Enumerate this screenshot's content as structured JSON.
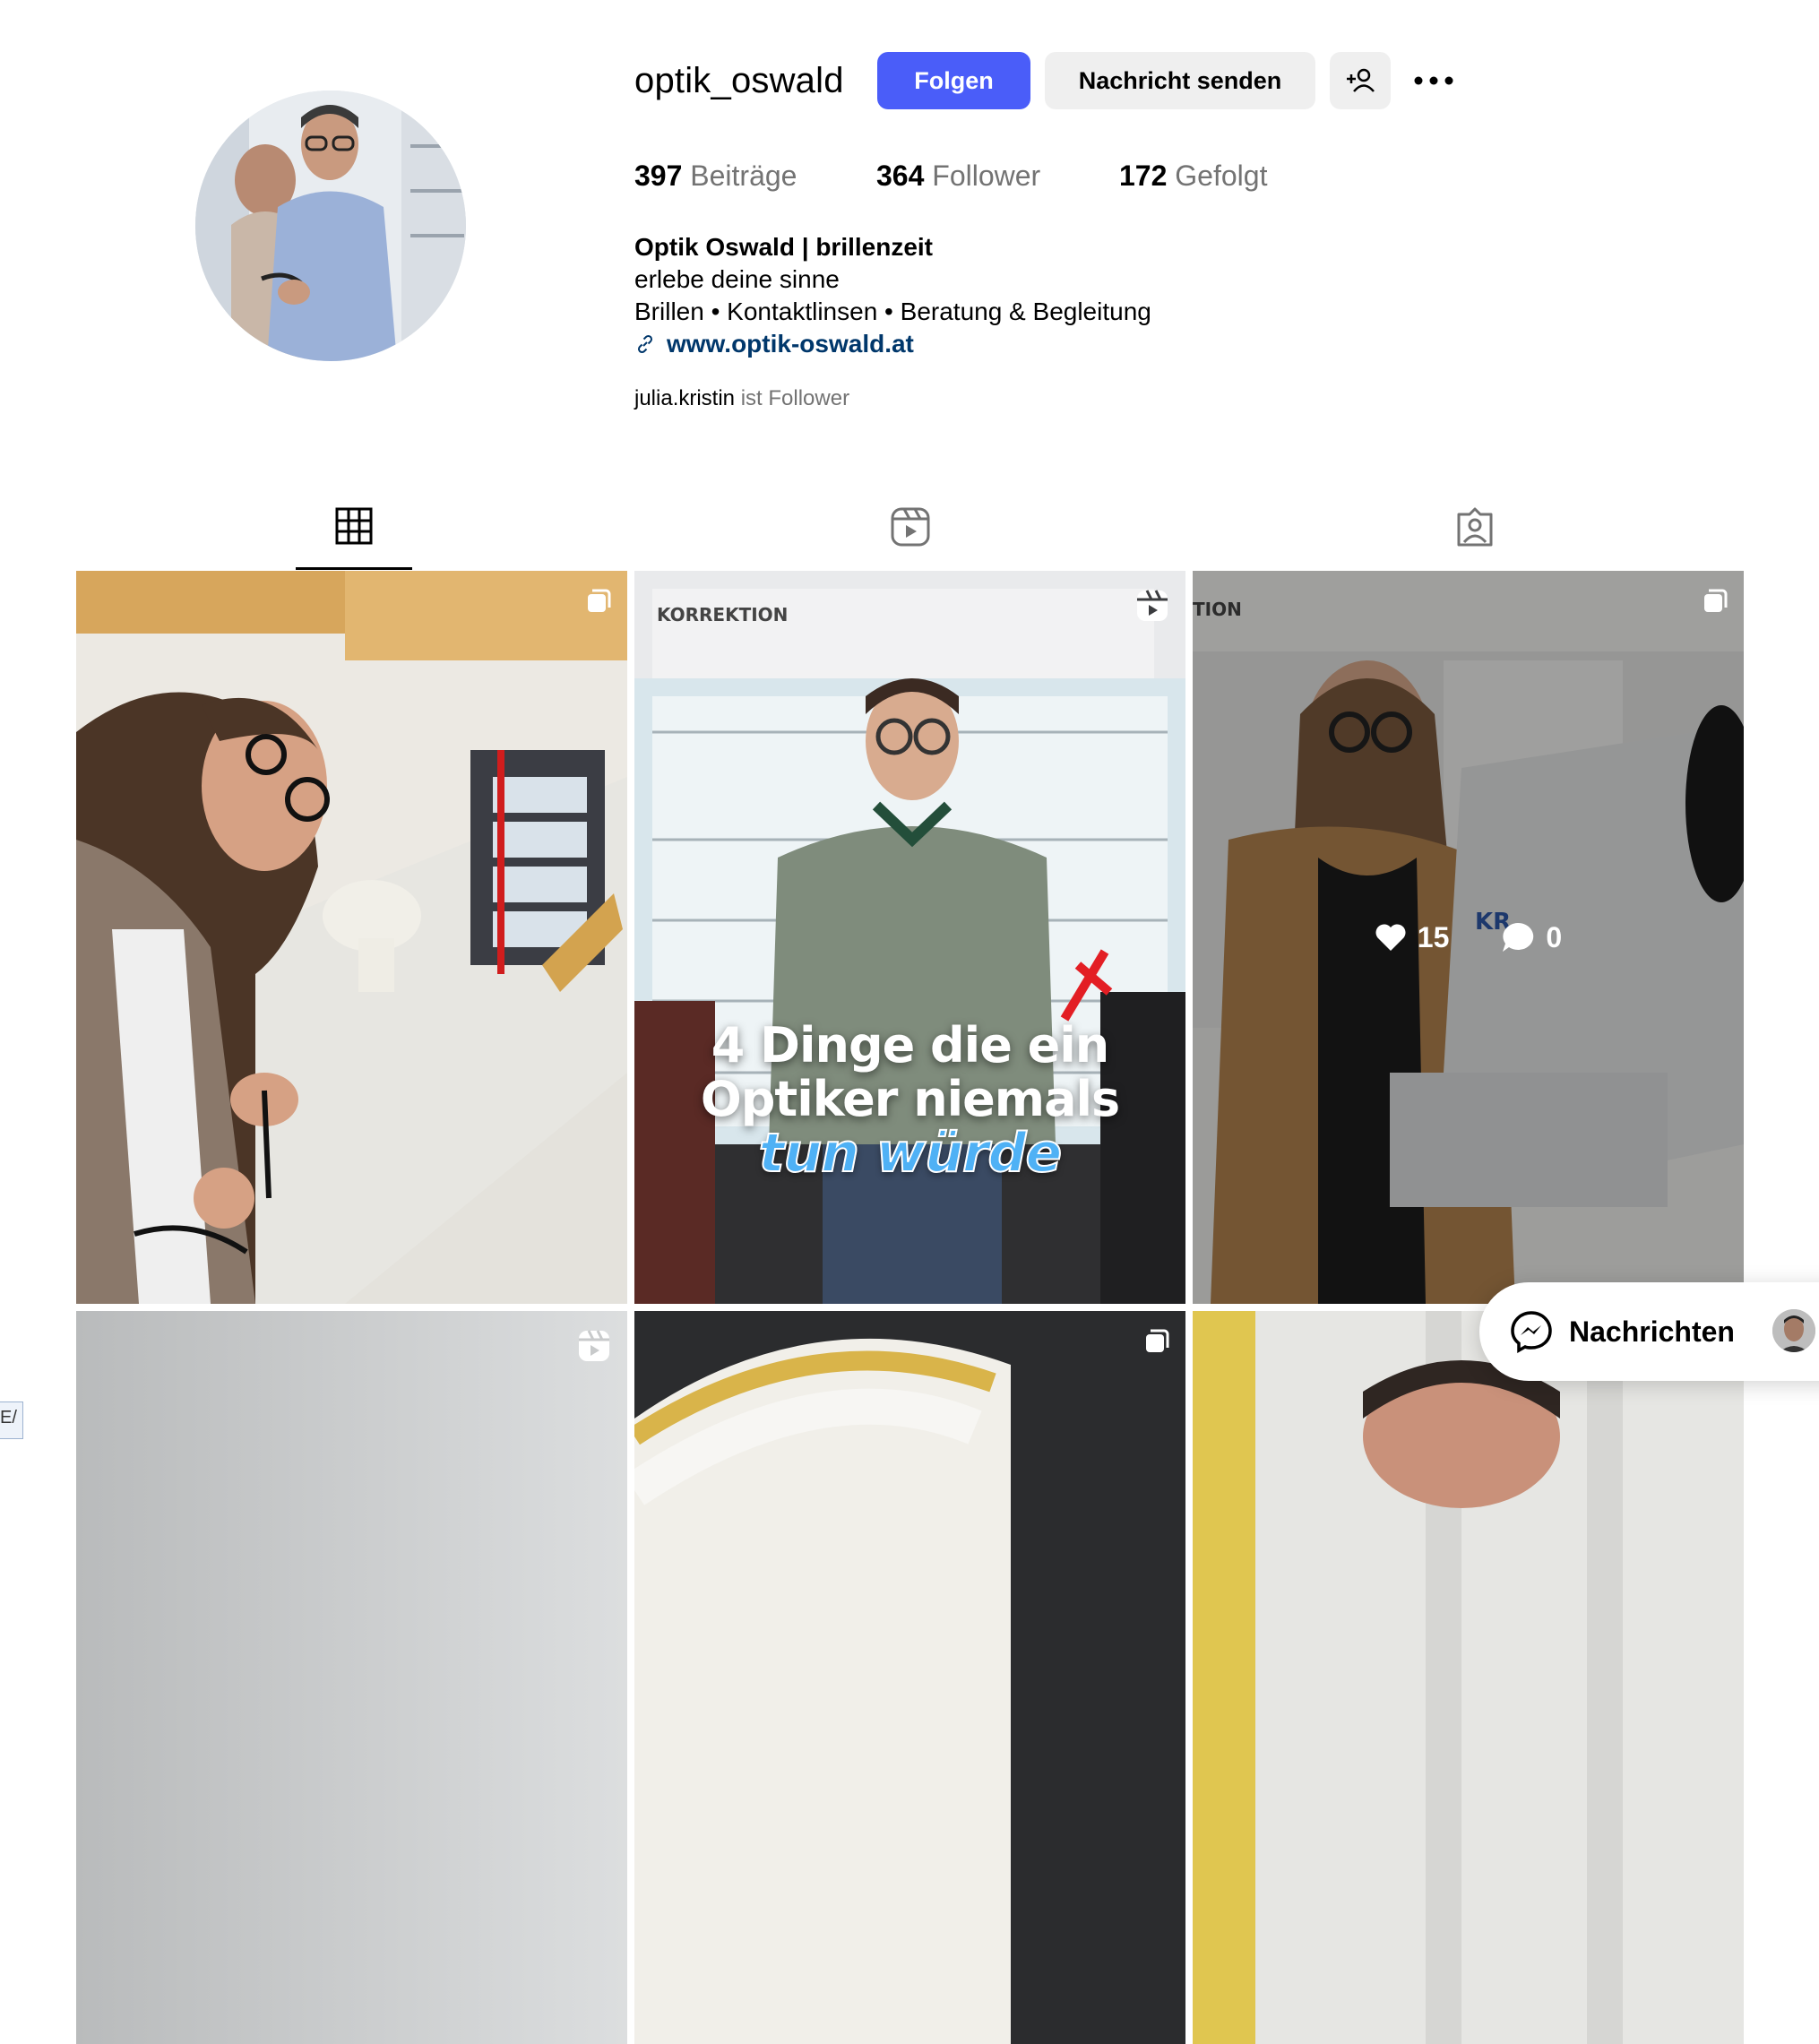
{
  "profile": {
    "username": "optik_oswald",
    "follow_label": "Folgen",
    "message_label": "Nachricht senden",
    "suggest_icon": "person-add-icon",
    "more_icon": "more-horizontal-icon",
    "stats": {
      "posts_count": "397",
      "posts_label": "Beiträge",
      "followers_count": "364",
      "followers_label": "Follower",
      "following_count": "172",
      "following_label": "Gefolgt"
    },
    "bio": {
      "name": "Optik Oswald | brillenzeit",
      "line1": "erlebe deine sinne",
      "line2": "Brillen • Kontaktlinsen • Beratung & Begleitung",
      "link": "www.optik-oswald.at"
    },
    "followed_by": {
      "user": "julia.kristin",
      "suffix": "ist Follower"
    }
  },
  "tabs": [
    {
      "icon": "grid-icon",
      "active": true
    },
    {
      "icon": "reels-icon",
      "active": false
    },
    {
      "icon": "tagged-icon",
      "active": false
    }
  ],
  "posts": [
    {
      "type": "carousel",
      "subject": "optician repairing glasses"
    },
    {
      "type": "reel",
      "subject": "optician in front of glasses display",
      "overlay_text": {
        "line1": "4 Dinge die ein",
        "line2": "Optiker niemals",
        "accent": "tun würde"
      },
      "sign_text": "KORREKTION"
    },
    {
      "type": "carousel",
      "subject": "optician at eye examination device",
      "likes": "15",
      "comments": "0",
      "sign_text": "TION",
      "device_text": "KR"
    },
    {
      "type": "reel",
      "subject": "optician portrait"
    },
    {
      "type": "carousel",
      "subject": "eye examination device"
    },
    {
      "type": "post",
      "subject": "optician portrait"
    }
  ],
  "messages": {
    "label": "Nachrichten",
    "icon": "messenger-icon"
  },
  "colors": {
    "primary_button": "#4a5df9",
    "secondary_button": "#efefef",
    "muted_text": "#737373",
    "link": "#00376b"
  }
}
